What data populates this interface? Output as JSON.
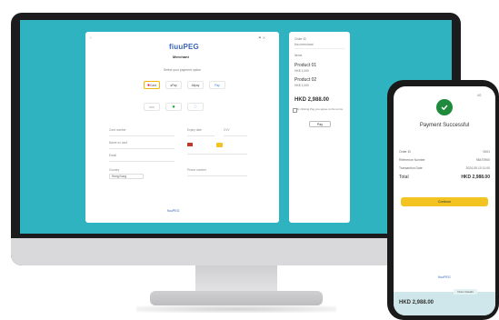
{
  "desktop": {
    "brand": "fiuuPEG",
    "merchant": "Merchant",
    "select_prompt": "Select your payment option",
    "methods": [
      "Card",
      "Pay",
      "Alipay",
      "Pay"
    ],
    "methods_row2": [
      "",
      "",
      ""
    ],
    "left_form_labels": [
      "Card number",
      "Name on card",
      "Email",
      "Country"
    ],
    "country_value": "Hong Kong",
    "right_form_labels": [
      "Expiry date",
      "CVV",
      "Phone number"
    ],
    "footer_brand": "fiuuPEG"
  },
  "summary": {
    "header_left": "Order ID",
    "header_right": "",
    "merchant": "fiuu merchant",
    "items_label": "Items",
    "product1": "Product 01",
    "product1_sub": "HK$ 1,000",
    "product2": "Product 02",
    "product2_sub": "HK$ 1,000",
    "total": "HKD 2,988.00",
    "note": "By clicking Pay you agree to the terms",
    "pay_button": "Pay"
  },
  "phone": {
    "status_right": "4G",
    "title": "Payment Successful",
    "rows": [
      {
        "label": "Order ID",
        "value": "0001"
      },
      {
        "label": "Reference Number",
        "value": "98470900"
      },
      {
        "label": "Transaction Date",
        "value": "2024-09-10 11:00"
      }
    ],
    "total_label": "Total",
    "total_value": "HKD 2,988.00",
    "continue_button": "Continue",
    "footer_brand": "fiuuPEG",
    "footer_tab": "Order Details",
    "footer_total": "HKD 2,988.00"
  },
  "colors": {
    "screen_teal": "#2fb3c1",
    "brand_blue": "#3a63b8",
    "success_green": "#1f8a3c",
    "button_yellow": "#f3c321"
  }
}
